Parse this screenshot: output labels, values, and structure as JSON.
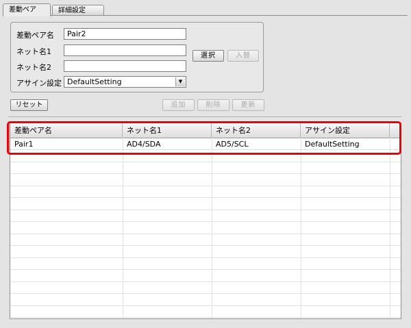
{
  "tabs": [
    {
      "label": "差動ペア",
      "active": true
    },
    {
      "label": "詳細設定",
      "active": false
    }
  ],
  "form": {
    "pair_name_label": "差動ペア名",
    "pair_name_value": "Pair2",
    "net1_label": "ネット名1",
    "net1_value": "",
    "net2_label": "ネット名2",
    "net2_value": "",
    "assign_label": "アサイン設定",
    "assign_value": "DefaultSetting"
  },
  "buttons": {
    "select": "選択",
    "swap": "入替",
    "reset": "リセット",
    "add": "追加",
    "delete": "削除",
    "update": "更新"
  },
  "table": {
    "columns": [
      "差動ペア名",
      "ネット名1",
      "ネット名2",
      "アサイン設定"
    ],
    "rows": [
      [
        "Pair1",
        "AD4/SDA",
        "AD5/SCL",
        "DefaultSetting"
      ]
    ]
  },
  "colors": {
    "highlight": "#e8000a"
  }
}
